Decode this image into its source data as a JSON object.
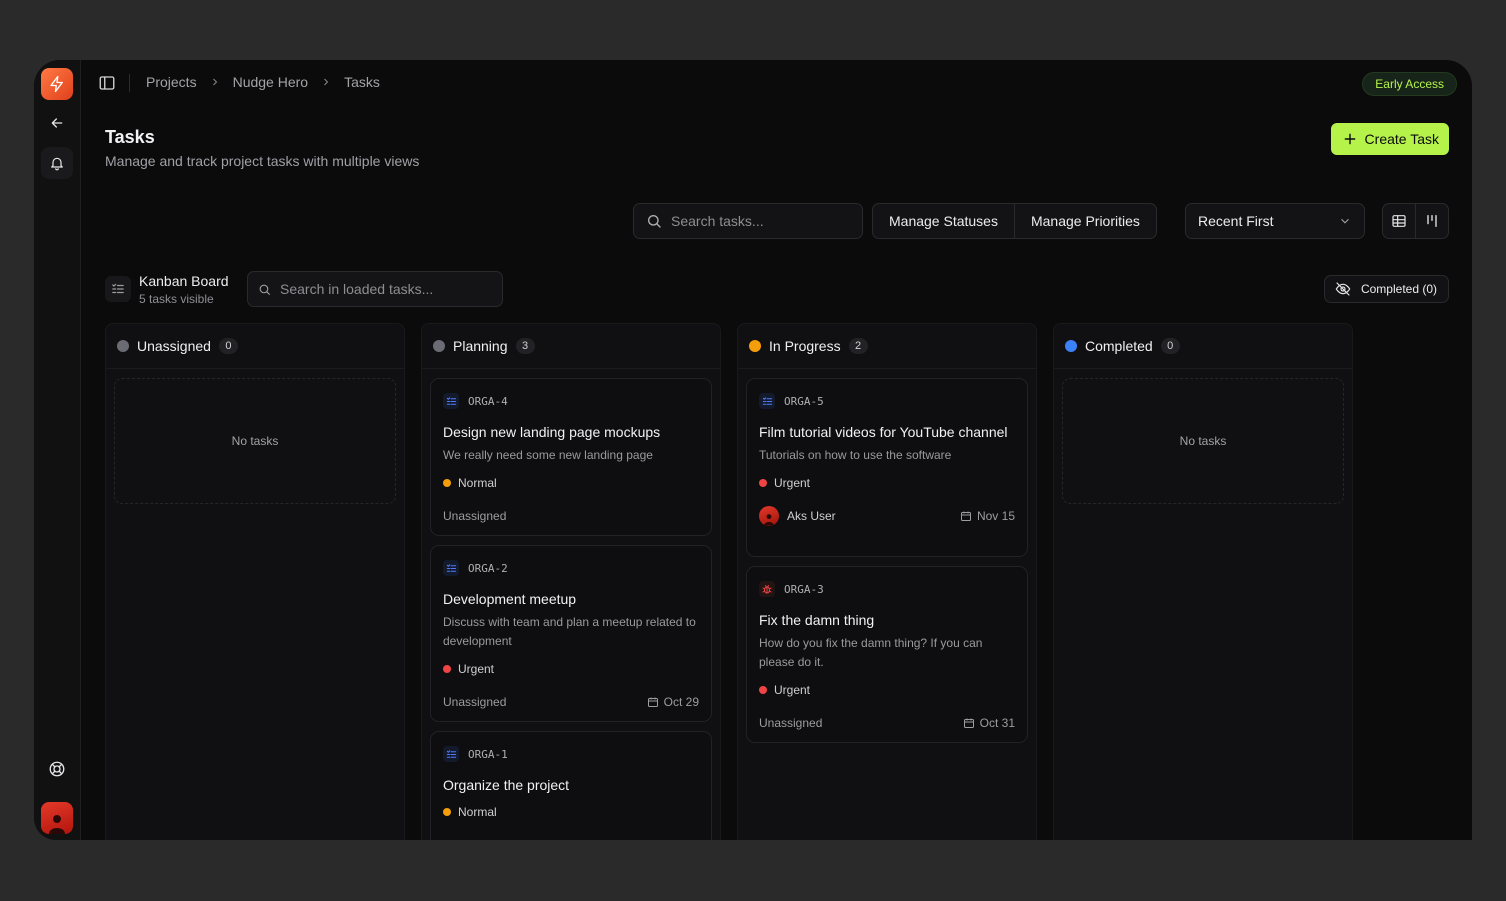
{
  "topbar": {
    "breadcrumb": [
      "Projects",
      "Nudge Hero",
      "Tasks"
    ],
    "early_access": "Early Access"
  },
  "header": {
    "title": "Tasks",
    "subtitle": "Manage and track project tasks with multiple views",
    "create_label": "Create Task"
  },
  "toolbar": {
    "search_placeholder": "Search tasks...",
    "manage_statuses": "Manage Statuses",
    "manage_priorities": "Manage Priorities",
    "sort_value": "Recent First"
  },
  "board": {
    "title": "Kanban Board",
    "visible": "5 tasks visible",
    "search_placeholder": "Search in loaded tasks...",
    "completed_toggle": "Completed (0)"
  },
  "colors": {
    "accent": "#b5f34a",
    "urgent": "#ef4444",
    "normal": "#f59e0b",
    "in_progress": "#f59e0b",
    "completed": "#3b82f6",
    "neutral": "#6b7280"
  },
  "columns": [
    {
      "name": "Unassigned",
      "count": "0",
      "color": "#6b6b73",
      "empty_text": "No tasks"
    },
    {
      "name": "Planning",
      "count": "3",
      "color": "#6b6b73"
    },
    {
      "name": "In Progress",
      "count": "2",
      "color": "#f59e0b"
    },
    {
      "name": "Completed",
      "count": "0",
      "color": "#3b82f6",
      "empty_text": "No tasks"
    }
  ],
  "tasks": {
    "orga4": {
      "id": "ORGA-4",
      "title": "Design new landing page mockups",
      "desc": "We really need some new landing page",
      "priority": "Normal",
      "assignee": "Unassigned",
      "icon": "task-icon"
    },
    "orga2": {
      "id": "ORGA-2",
      "title": "Development meetup",
      "desc": "Discuss with team and plan a meetup related to development",
      "priority": "Urgent",
      "assignee": "Unassigned",
      "due": "Oct 29",
      "icon": "task-icon"
    },
    "orga1": {
      "id": "ORGA-1",
      "title": "Organize the project",
      "priority": "Normal",
      "icon": "task-icon"
    },
    "orga5": {
      "id": "ORGA-5",
      "title": "Film tutorial videos for YouTube channel",
      "desc": "Tutorials on how to use the software",
      "priority": "Urgent",
      "assignee": "Aks User",
      "due": "Nov 15",
      "icon": "task-icon"
    },
    "orga3": {
      "id": "ORGA-3",
      "title": "Fix the damn thing",
      "desc": "How do you fix the damn thing? If you can please do it.",
      "priority": "Urgent",
      "assignee": "Unassigned",
      "due": "Oct 31",
      "icon": "bug-icon"
    }
  }
}
